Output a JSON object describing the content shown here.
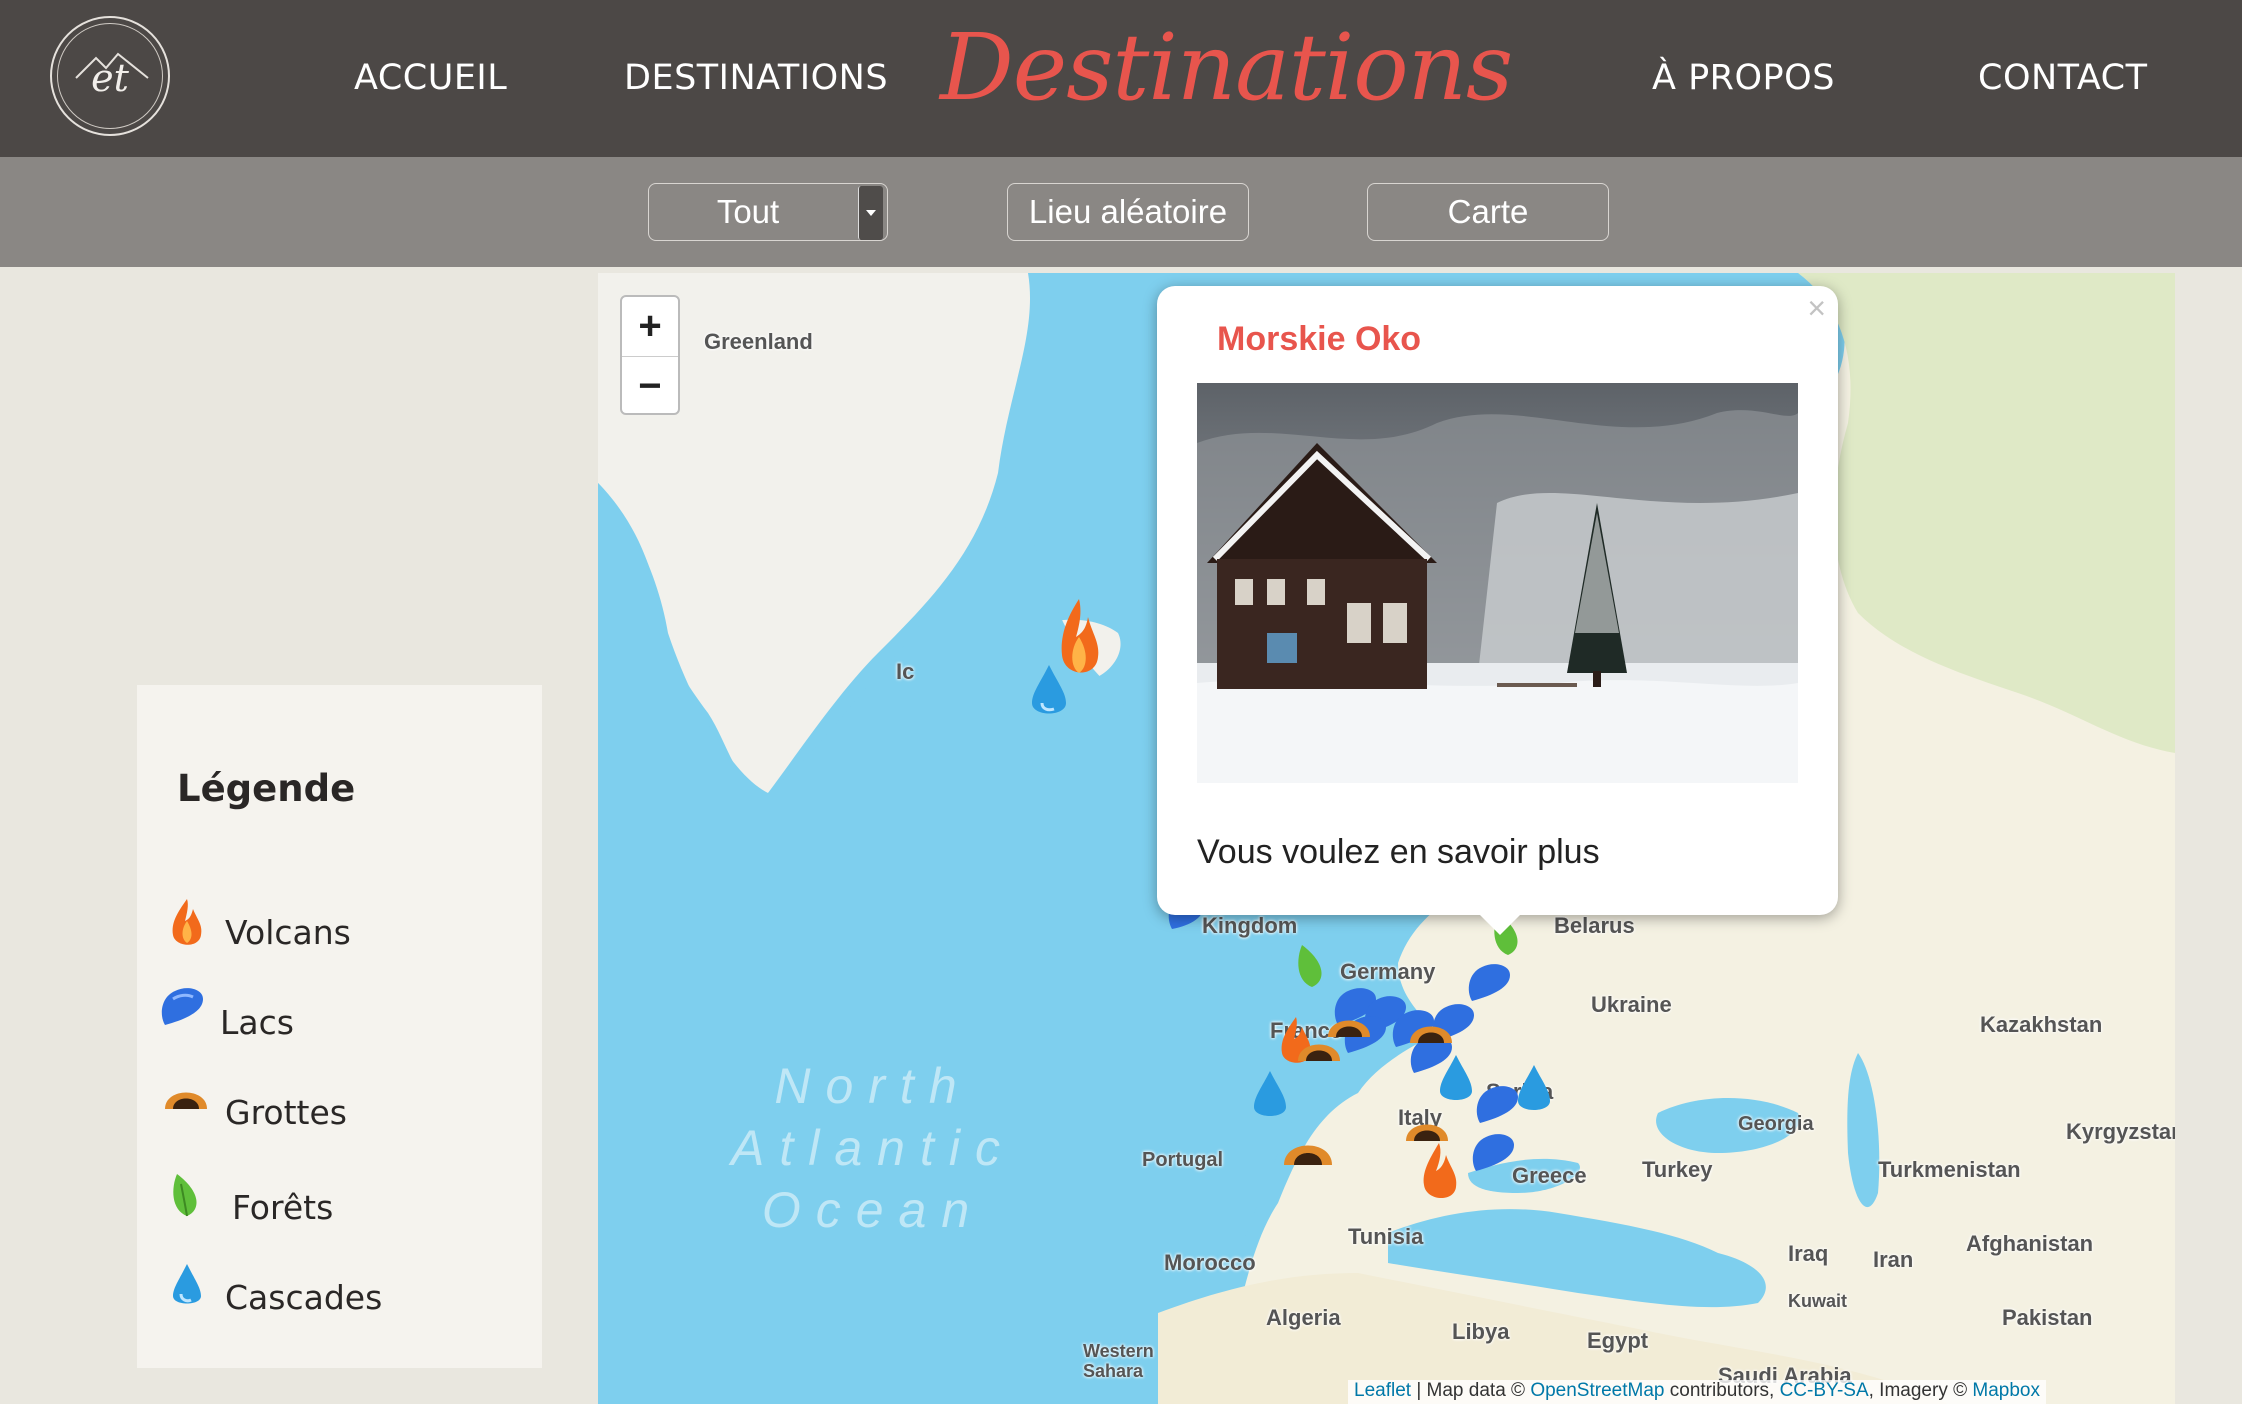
{
  "nav": {
    "logo_text": "et",
    "brand": "Destinations",
    "links": [
      "ACCUEIL",
      "DESTINATIONS",
      "À PROPOS",
      "CONTACT"
    ]
  },
  "filters": {
    "select_value": "Tout",
    "random_label": "Lieu aléatoire",
    "map_label": "Carte"
  },
  "legend": {
    "title": "Légende",
    "items": [
      {
        "label": "Volcans",
        "icon": "volcano-icon",
        "color": "#f26a1b"
      },
      {
        "label": "Lacs",
        "icon": "lake-icon",
        "color": "#2f6fe0"
      },
      {
        "label": "Grottes",
        "icon": "cave-icon",
        "color": "#8a4a16"
      },
      {
        "label": "Forêts",
        "icon": "forest-icon",
        "color": "#5fbf3a"
      },
      {
        "label": "Cascades",
        "icon": "waterfall-icon",
        "color": "#2a9be0"
      }
    ]
  },
  "map": {
    "zoom_in": "+",
    "zoom_out": "−",
    "labels": {
      "greenland": "Greenland",
      "kingdom": "Kingdom",
      "belarus": "Belarus",
      "germany": "Germany",
      "ukraine": "Ukraine",
      "kazakhstan": "Kazakhstan",
      "france": "France",
      "serbia": "Serbia",
      "italy": "Italy",
      "georgia": "Georgia",
      "kyrgyzstan": "Kyrgyzstan",
      "portugal": "Portugal",
      "greece": "Greece",
      "turkey": "Turkey",
      "turkmenistan": "Turkmenistan",
      "afghanistan": "Afghanistan",
      "tunisia": "Tunisia",
      "morocco": "Morocco",
      "iraq": "Iraq",
      "iran": "Iran",
      "kuwait": "Kuwait",
      "algeria": "Algeria",
      "libya": "Libya",
      "egypt": "Egypt",
      "pakistan": "Pakistan",
      "western_sahara": "Western Sahara",
      "saudi_arabia": "Saudi Arabia",
      "ocean": "North Atlantic Ocean",
      "iceland_partial": "Ic"
    },
    "attribution": {
      "leaflet": "Leaflet",
      "sep1": " | Map data © ",
      "osm": "OpenStreetMap",
      "sep2": " contributors, ",
      "license": "CC-BY-SA",
      "sep3": ", Imagery © ",
      "provider": "Mapbox"
    }
  },
  "popup": {
    "close": "×",
    "title": "Morskie Oko",
    "link_text": "Vous voulez en savoir plus"
  }
}
